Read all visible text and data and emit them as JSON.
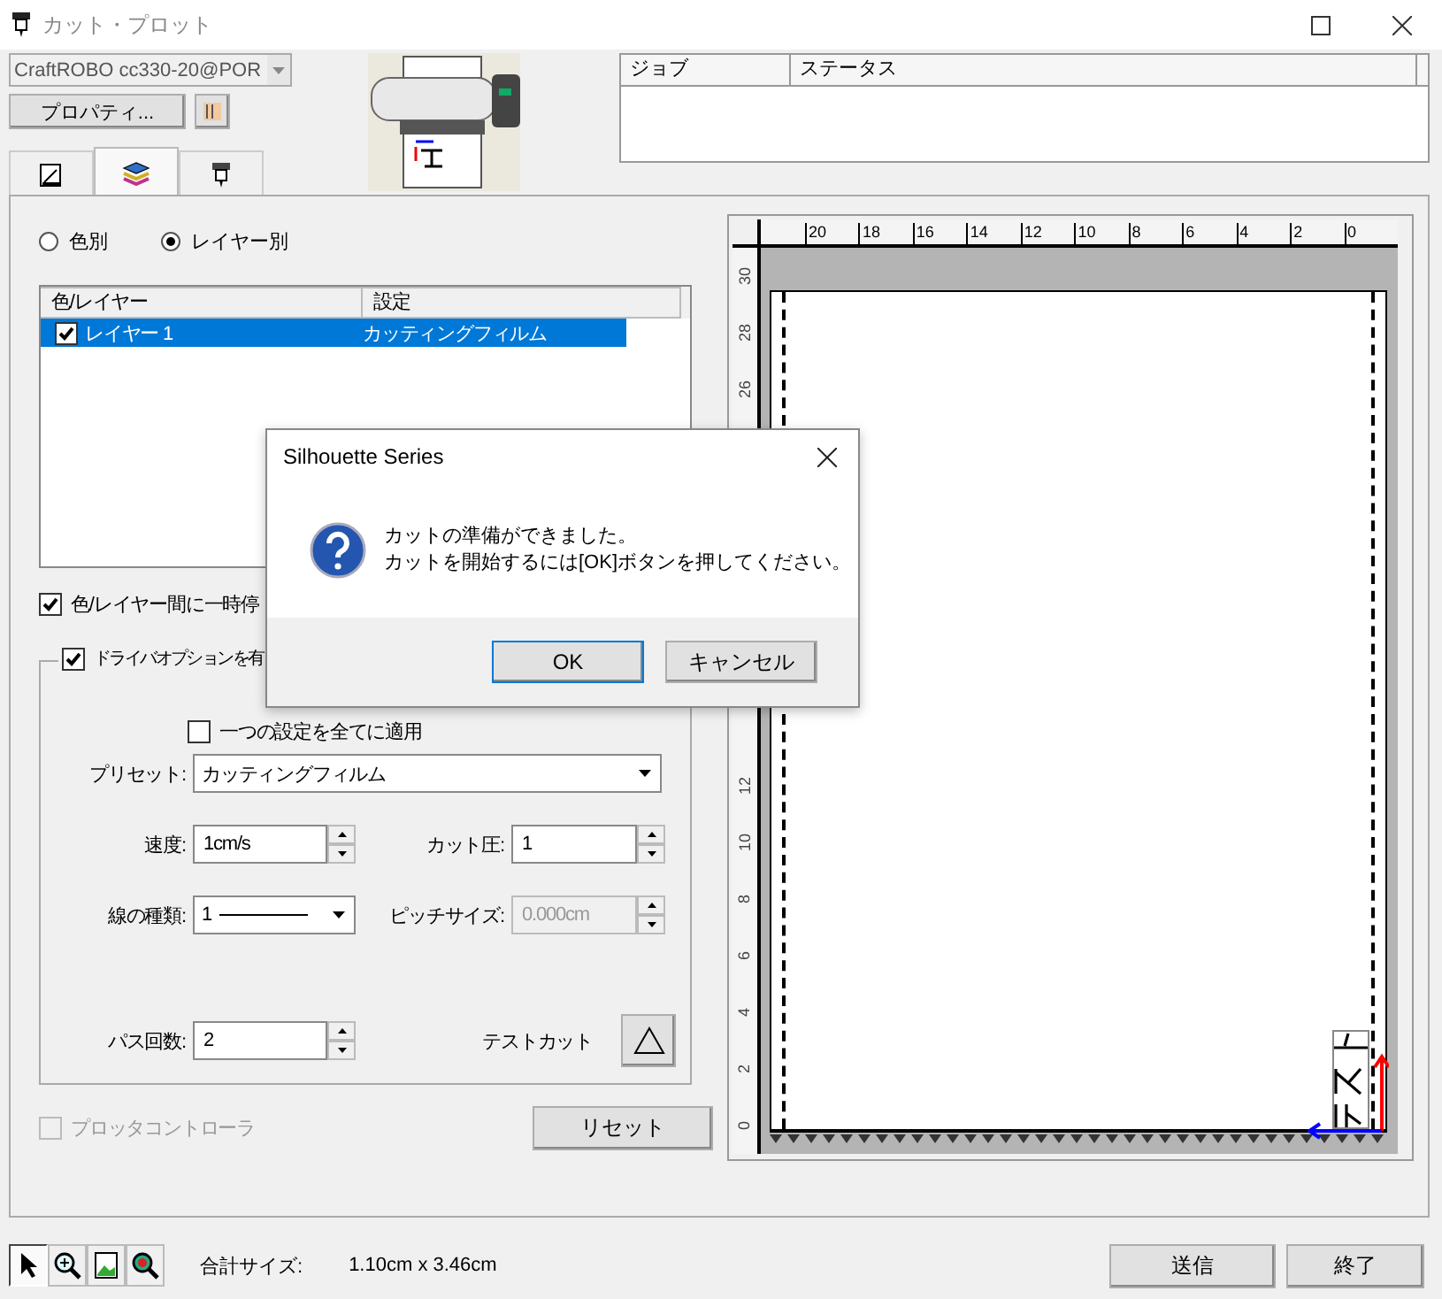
{
  "window": {
    "title": "カット・プロット"
  },
  "printer": {
    "value": "CraftROBO cc330-20@POR"
  },
  "properties_button": "プロパティ...",
  "tabs": [
    {
      "kind": "page",
      "selected": false
    },
    {
      "kind": "layers",
      "selected": true
    },
    {
      "kind": "cutter",
      "selected": false
    }
  ],
  "job_table": {
    "columns": [
      "ジョブ",
      "ステータス"
    ]
  },
  "sort_options": [
    {
      "label": "色別",
      "selected": false
    },
    {
      "label": "レイヤー別",
      "selected": true
    }
  ],
  "layer_table": {
    "columns": [
      "色/レイヤー",
      "設定"
    ],
    "rows": [
      {
        "checked": true,
        "selected": true,
        "name": "レイヤー 1",
        "setting": "カッティングフィルム"
      }
    ]
  },
  "pause_between": {
    "label": "色/レイヤー間に一時停",
    "checked": true
  },
  "driver_options": {
    "label": "ドライバオプションを有",
    "checked": true,
    "apply_all": {
      "label": "一つの設定を全てに適用",
      "checked": false
    },
    "preset": {
      "label": "プリセット:",
      "value": "カッティングフィルム"
    },
    "speed": {
      "label": "速度:",
      "value": "1cm/s"
    },
    "pressure": {
      "label": "カット圧:",
      "value": "1"
    },
    "line_type": {
      "label": "線の種類:",
      "value": "1"
    },
    "pitch": {
      "label": "ピッチサイズ:",
      "value": "0.000cm",
      "disabled": true
    },
    "passes": {
      "label": "パス回数:",
      "value": "2"
    },
    "test_cut": {
      "label": "テストカット"
    }
  },
  "plotter_controller": {
    "label": "プロッタコントローラ",
    "checked": false,
    "disabled": true
  },
  "reset_button": "リセット",
  "preview": {
    "top_ruler": [
      "20",
      "18",
      "16",
      "14",
      "12",
      "10",
      "8",
      "6",
      "4",
      "2",
      "0"
    ],
    "left_ruler_upper": [
      "30",
      "28",
      "26"
    ],
    "left_ruler_lower": [
      "12",
      "10",
      "8",
      "6",
      "4",
      "2",
      "0"
    ]
  },
  "tools": [
    {
      "kind": "pointer",
      "selected": true
    },
    {
      "kind": "zoom-in",
      "selected": false
    },
    {
      "kind": "page",
      "selected": false
    },
    {
      "kind": "zoom-area",
      "selected": false
    }
  ],
  "total_size": {
    "label": "合計サイズ:",
    "value": "1.10cm x 3.46cm"
  },
  "buttons": [
    "送信",
    "終了"
  ],
  "dialog": {
    "title": "Silhouette Series",
    "message": [
      "カットの準備ができました。",
      "カットを開始するには[OK]ボタンを押してください。"
    ],
    "buttons": [
      "OK",
      "キャンセル"
    ]
  }
}
